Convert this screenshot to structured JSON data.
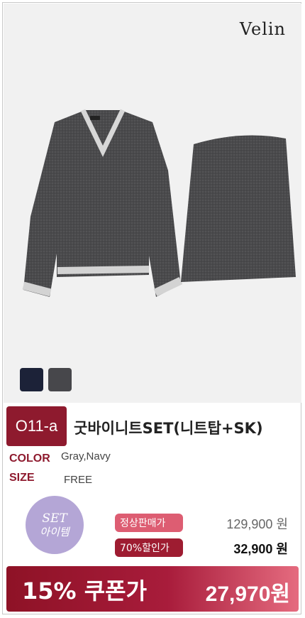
{
  "brand": "Velin",
  "product": {
    "code": "O11-a",
    "name": "굿바이니트SET(니트탑+SK)",
    "color_label": "COLOR",
    "color_value": "Gray,Navy",
    "size_label": "SIZE",
    "size_value": "FREE",
    "swatches": [
      {
        "name": "navy",
        "hex": "#1c2238"
      },
      {
        "name": "gray",
        "hex": "#47474b"
      }
    ]
  },
  "badge": {
    "line1": "SET",
    "line2": "아이템"
  },
  "pricing": {
    "regular_label": "정상판매가",
    "regular_price": "129,900 원",
    "discount_label": "70%할인가",
    "discount_price": "32,900 원"
  },
  "coupon": {
    "label": "15% 쿠폰가",
    "price": "27,970원"
  },
  "colors": {
    "accent": "#8e1a2e",
    "pink": "#dd5d72",
    "lavender": "#b4a6d6"
  }
}
